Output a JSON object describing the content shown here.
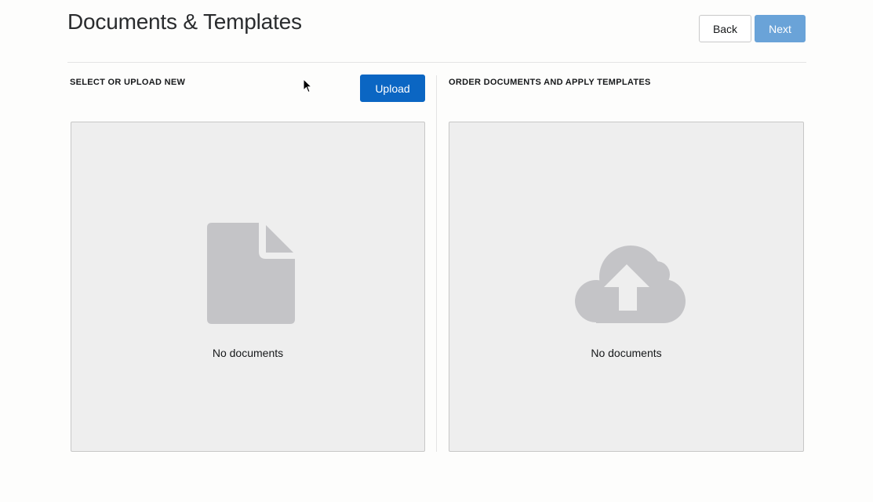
{
  "header": {
    "title": "Documents & Templates",
    "back_label": "Back",
    "next_label": "Next"
  },
  "left_section": {
    "heading": "SELECT OR UPLOAD NEW",
    "upload_label": "Upload",
    "empty_text": "No documents",
    "icon": "document-icon"
  },
  "right_section": {
    "heading": "ORDER DOCUMENTS AND APPLY TEMPLATES",
    "empty_text": "No documents",
    "icon": "cloud-upload-icon"
  },
  "colors": {
    "primary": "#0b66c3",
    "primary_disabled": "#6aa3d8",
    "panel_bg": "#eeeeee",
    "icon_gray": "#c4c4c7"
  }
}
